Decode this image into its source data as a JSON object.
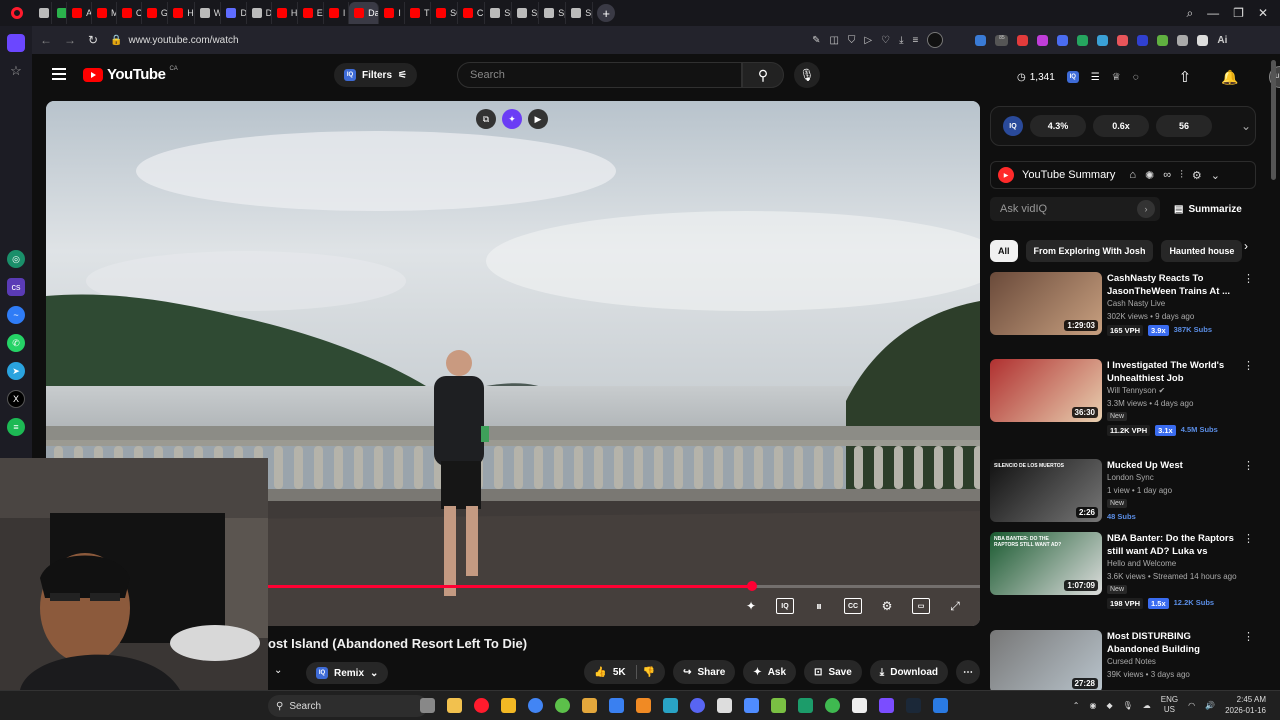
{
  "browser": {
    "tabs": [
      {
        "label": "··",
        "fav": "grey"
      },
      {
        "label": "",
        "fav": "green"
      },
      {
        "label": "A Murd",
        "fav": "red"
      },
      {
        "label": "Most D",
        "fav": "red"
      },
      {
        "label": "Cursed",
        "fav": "red"
      },
      {
        "label": "Ghost H",
        "fav": "red"
      },
      {
        "label": "He spen",
        "fav": "red"
      },
      {
        "label": "Watch D",
        "fav": "grey"
      },
      {
        "label": "Dragon",
        "fav": "blue"
      },
      {
        "label": "Dragon",
        "fav": "grey"
      },
      {
        "label": "How I B",
        "fav": "red"
      },
      {
        "label": "Explorin",
        "fav": "red"
      },
      {
        "label": "I tested",
        "fav": "red"
      },
      {
        "label": "Dark Secre",
        "fav": "red",
        "active": true
      },
      {
        "label": "I Investi",
        "fav": "red"
      },
      {
        "label": "The Bra",
        "fav": "red"
      },
      {
        "label": "SO HAU",
        "fav": "red"
      },
      {
        "label": "CES 202",
        "fav": "red"
      },
      {
        "label": "Speed D",
        "fav": "grey"
      },
      {
        "label": "Speed D",
        "fav": "grey"
      },
      {
        "label": "Speed D",
        "fav": "grey"
      },
      {
        "label": "Speed D",
        "fav": "grey"
      }
    ],
    "new_tab": "+",
    "window_controls": [
      "⌕",
      "—",
      "❐",
      "✕"
    ],
    "url": "www.youtube.com/watch",
    "ext_badge": "85",
    "ai_label": "Ai"
  },
  "yt": {
    "logo": "YouTube",
    "region": "CA",
    "filters": "Filters",
    "search_placeholder": "Search",
    "notif_count": "1,341",
    "avatar": "SURU"
  },
  "video": {
    "progress": 0.68,
    "title": "ost Island (Abandoned Resort Left To Die)",
    "title_prefix": "h",
    "remix": "Remix",
    "likes": "5K",
    "share": "Share",
    "ask": "Ask",
    "save": "Save",
    "download": "Download"
  },
  "vidiq": {
    "stats": [
      "4.3%",
      "0.6x",
      "56"
    ],
    "summary_title": "YouTube Summary",
    "ask_placeholder": "Ask vidIQ",
    "summarize": "Summarize"
  },
  "chips": [
    "All",
    "From Exploring With Josh",
    "Haunted house"
  ],
  "recommendations": [
    {
      "title": "CashNasty Reacts To JasonTheWeen Trains At ...",
      "channel": "Cash Nasty Live",
      "meta": "302K views • 9 days ago",
      "duration": "1:29:03",
      "new": false,
      "vph": "165 VPH",
      "mult": "3.9x",
      "subs": "387K Subs"
    },
    {
      "title": "I Investigated The World's Unhealthiest Job",
      "channel": "Will Tennyson",
      "verified": true,
      "meta": "3.3M views • 4 days ago",
      "duration": "36:30",
      "new": true,
      "vph": "11.2K VPH",
      "mult": "3.1x",
      "subs": "4.5M Subs"
    },
    {
      "title": "Mucked Up West",
      "channel": "London Sync",
      "meta": "1 view • 1 day ago",
      "duration": "2:26",
      "new": true,
      "vph": "",
      "mult": "",
      "subs": "48 Subs",
      "thumb_text": "SILENCIO DE LOS MUERTOS"
    },
    {
      "title": "NBA Banter: Do the Raptors still want AD? Luka vs Dennis, Spu...",
      "channel": "Hello and Welcome",
      "meta": "3.6K views • Streamed 14 hours ago",
      "duration": "1:07:09",
      "new": true,
      "vph": "198 VPH",
      "mult": "1.5x",
      "subs": "12.2K Subs",
      "thumb_text": "NBA BANTER: DO THE RAPTORS STILL WANT AD?"
    },
    {
      "title": "Most DISTURBING Abandoned Building Encounters Caught o...",
      "channel": "Cursed Notes",
      "meta": "39K views • 3 days ago",
      "duration": "27:28",
      "new": false,
      "vph": "",
      "mult": "",
      "subs": ""
    }
  ],
  "taskbar": {
    "search": "Search",
    "lang_top": "ENG",
    "lang_bottom": "US",
    "time": "2:45 AM",
    "date": "2026-01-16"
  },
  "icons": {
    "notify": "bell-icon",
    "upload": "upload-icon",
    "mic": "mic-icon",
    "search": "search-icon"
  },
  "colors": {
    "accent_red": "#ff0033",
    "vidiq_blue": "#3a6cf0"
  }
}
